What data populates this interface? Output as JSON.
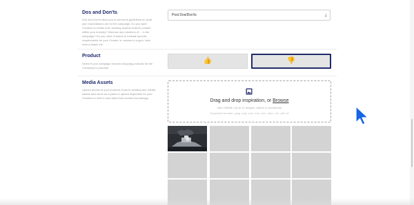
{
  "dos_donts": {
    "title": "Dos and Don'ts",
    "description": "Dos and Don'ts allow you to set some guidelines on what your expectations are for the campaign. Do you want Creators to refrain from wearing another brand's content within your industry? Disclose any mentions of ... in the campaign? Do you need Creators to indicate specific requirements for your Creator. ie. access to a gym, lives near a beach etc.",
    "select_value": "Post Dos/Don'ts"
  },
  "product": {
    "title": "Product",
    "description": "Select if your campaign involves shipping products for the Creator(s) to promote.",
    "options": [
      {
        "icon": "thumbs-up-icon",
        "selected": false
      },
      {
        "icon": "thumbs-down-icon",
        "selected": true
      }
    ]
  },
  "media_assets": {
    "title": "Media Assets",
    "description": "Upload photos of your products if you're sending any. Media assets also serve as a place to upload inspiration for your Creators to refer to and tailor their content accordingly.",
    "dropzone": {
      "main_prefix": "Drag and drop inspiration, or ",
      "browse_label": "Browse",
      "limits": "Max 100MB | Up to 12 images, videos or documents",
      "formats": "Supported formats: .jpeg .png .mp4 .mov .doc .docx .csv .pdf .txt"
    }
  },
  "colors": {
    "accent": "#1f2a6b",
    "placeholder_tile": "#d3d3d3",
    "cursor": "#1565e6"
  }
}
